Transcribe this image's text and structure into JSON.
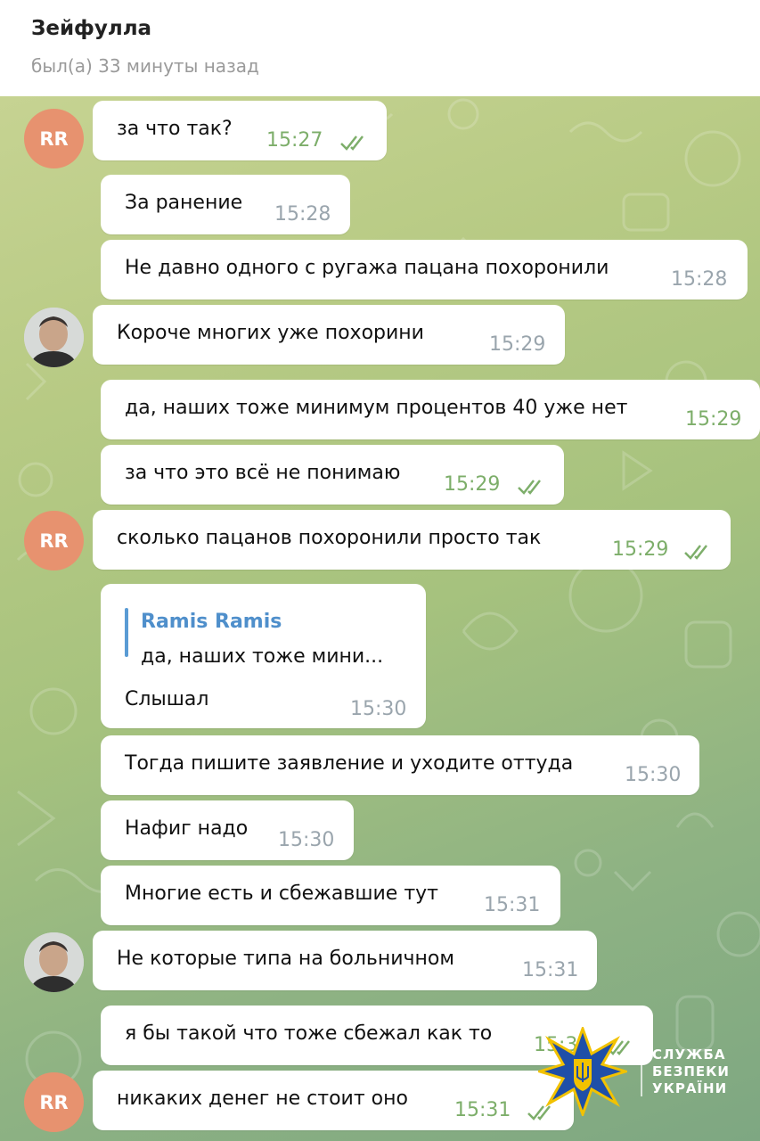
{
  "header": {
    "title": "Зейфулла",
    "status": "был(а) 33 минуты назад"
  },
  "avatars": {
    "rr_label": "RR"
  },
  "messages": [
    {
      "text": "за что так?",
      "time": "15:27",
      "read": true
    },
    {
      "text": "За ранение",
      "time": "15:28"
    },
    {
      "text": "Не давно одного с ругажа пацана похоронили",
      "time": "15:28"
    },
    {
      "text": "Короче многих уже похорини",
      "time": "15:29"
    },
    {
      "text": "да, наших тоже минимум процентов 40 уже нет",
      "time": "15:29"
    },
    {
      "text": "за что это всё не понимаю",
      "time": "15:29",
      "read": true
    },
    {
      "text": "сколько пацанов похоронили просто так",
      "time": "15:29",
      "read": true
    },
    {
      "reply_name": "Ramis Ramis",
      "reply_text": "да, наших тоже мини...",
      "text": "Слышал",
      "time": "15:30"
    },
    {
      "text": "Тогда пишите заявление и  уходите оттуда",
      "time": "15:30"
    },
    {
      "text": "Нафиг надо",
      "time": "15:30"
    },
    {
      "text": "Многие есть и сбежавшие тут",
      "time": "15:31"
    },
    {
      "text": "Не которые типа на больничном",
      "time": "15:31"
    },
    {
      "text": "я бы такой что тоже сбежал как то",
      "time": "15:31",
      "read": true
    },
    {
      "text": "никаких денег не стоит оно",
      "time": "15:31",
      "read": true
    }
  ],
  "watermark": {
    "line1": "СЛУЖБА",
    "line2": "БЕЗПЕКИ",
    "line3": "УКРАЇНИ"
  },
  "colors": {
    "rr_avatar": "#e7926f",
    "read_check": "#7dae6a",
    "reply_accent": "#4f8fcb",
    "sbu_blue": "#1f4fa8",
    "sbu_gold": "#f2c200"
  }
}
